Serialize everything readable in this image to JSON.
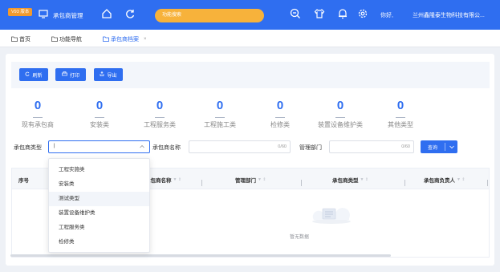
{
  "header": {
    "version_badge": "V93 版本",
    "app_title": "承包商管理",
    "search_placeholder": "功能搜索",
    "username": "你好,",
    "company": "兰州鑫隆泰生物科技有限公..."
  },
  "tabs": [
    {
      "label": "首页",
      "active": false
    },
    {
      "label": "功能导航",
      "active": false
    },
    {
      "label": "承包商档案",
      "active": true
    }
  ],
  "toolbar": {
    "refresh_label": "刷新",
    "print_label": "打印",
    "export_label": "导出"
  },
  "stats": [
    {
      "value": "0",
      "label": "现有承包商"
    },
    {
      "value": "0",
      "label": "安装类"
    },
    {
      "value": "0",
      "label": "工程服务类"
    },
    {
      "value": "0",
      "label": "工程施工类"
    },
    {
      "value": "0",
      "label": "检修类"
    },
    {
      "value": "0",
      "label": "装置设备维护类"
    },
    {
      "value": "0",
      "label": "其他类型"
    }
  ],
  "filters": {
    "type_label": "承包商类型",
    "type_value": "|",
    "name_label": "承包商名称",
    "name_counter": "0/60",
    "dept_label": "管理部门",
    "dept_counter": "0/60",
    "query_label": "查询"
  },
  "table": {
    "columns": [
      "序号",
      "承包商名称",
      "管理部门",
      "承包商类型",
      "承包商负责人"
    ],
    "empty_text": "暂无数据"
  },
  "dropdown": {
    "options": [
      "工程实施类",
      "安装类",
      "测试类型",
      "装置设备维护类",
      "工程服务类",
      "检修类"
    ],
    "hovered_index": 2
  },
  "colors": {
    "primary": "#2f6ef0",
    "accent_orange": "#f29a2e",
    "search_bg": "#f7b23b"
  }
}
